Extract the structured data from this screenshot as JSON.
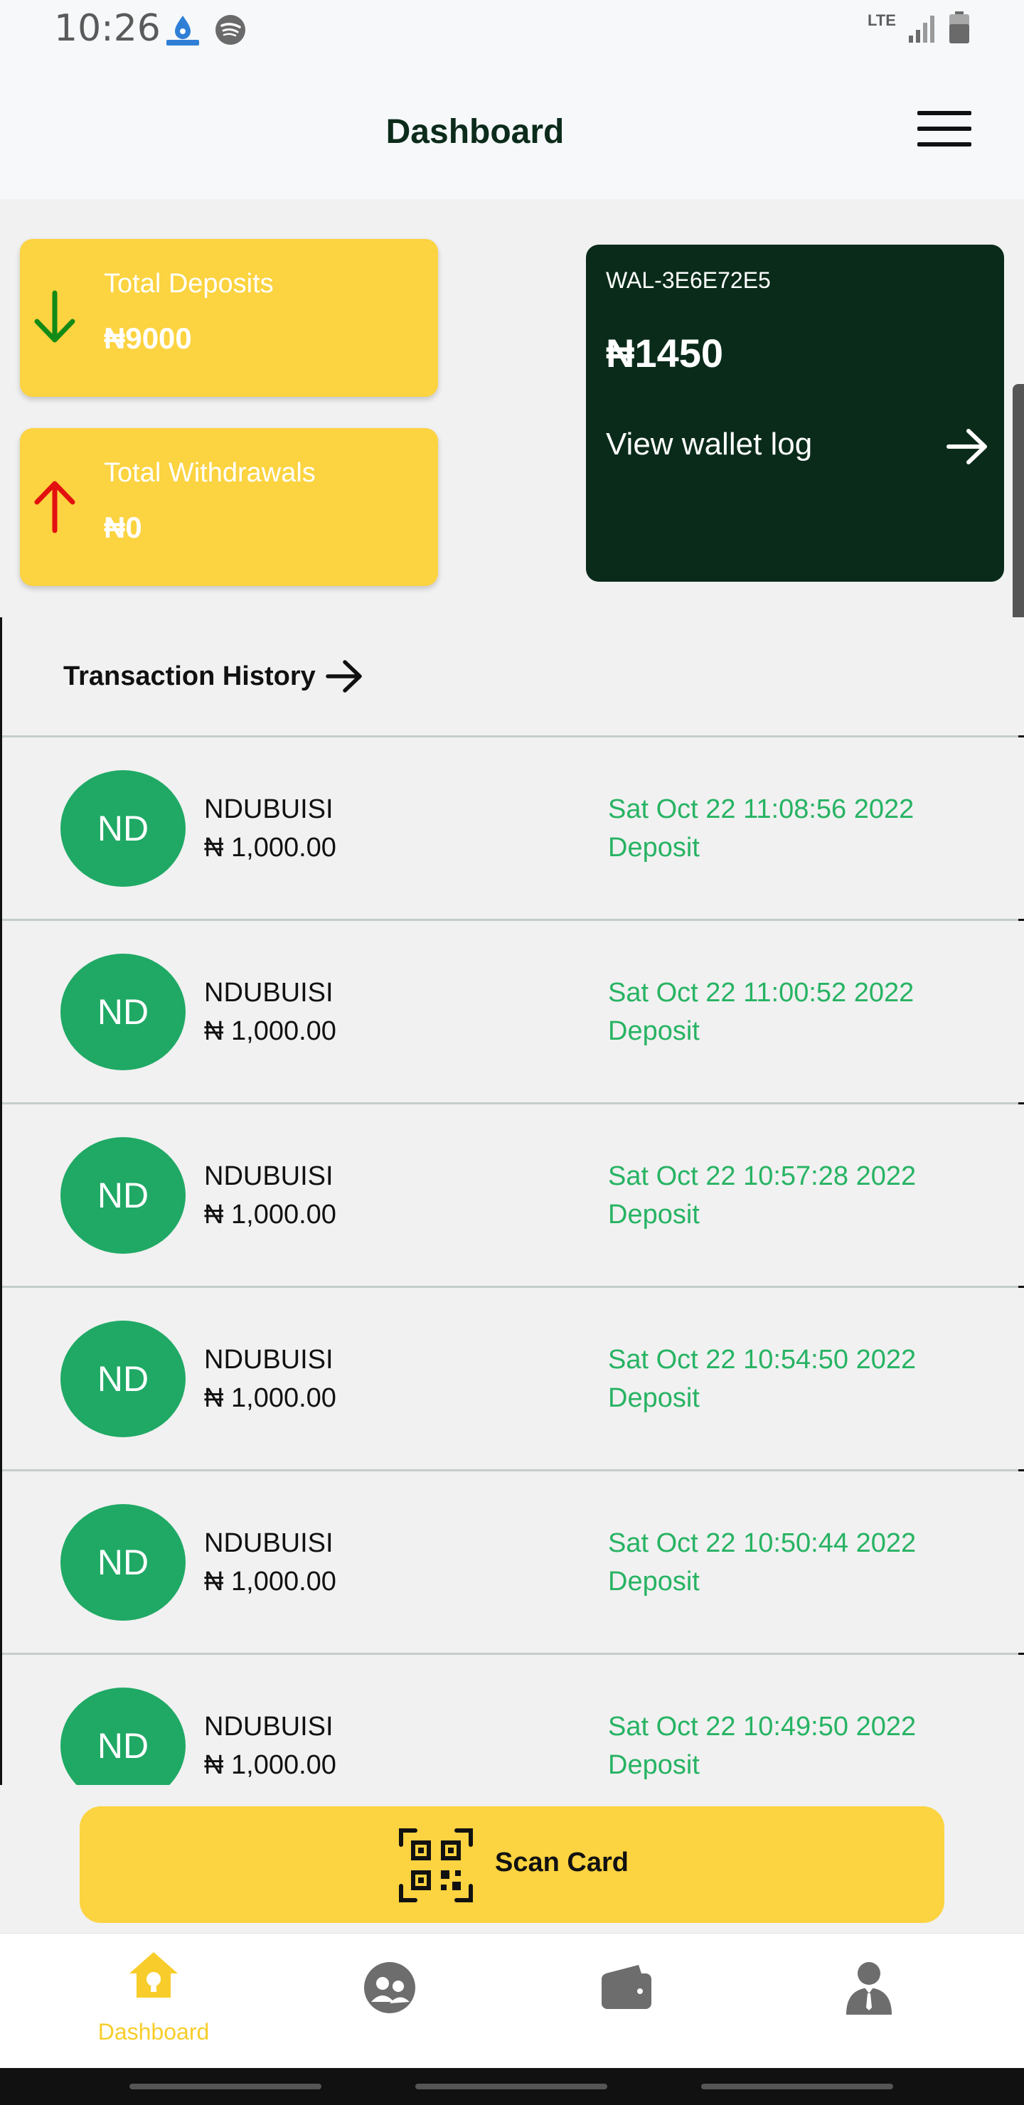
{
  "status_bar": {
    "time": "10:26",
    "network": "LTE",
    "icons": [
      "app-notification-icon",
      "spotify-icon",
      "signal-icon",
      "battery-icon"
    ]
  },
  "header": {
    "title": "Dashboard",
    "menu_icon": "hamburger-menu-icon"
  },
  "stats": {
    "deposits": {
      "label": "Total Deposits",
      "value": "₦9000",
      "icon": "arrow-down-icon",
      "icon_color": "#138a16"
    },
    "withdrawals": {
      "label": "Total Withdrawals",
      "value": "₦0",
      "icon": "arrow-up-icon",
      "icon_color": "#e31010"
    }
  },
  "wallet": {
    "id": "WAL-3E6E72E5",
    "balance": "₦1450",
    "log_label": "View wallet log",
    "arrow_icon": "arrow-right-icon"
  },
  "transactions": {
    "title": "Transaction History",
    "items": [
      {
        "initials": "ND",
        "name": "NDUBUISI",
        "amount": "₦ 1,000.00",
        "date": "Sat Oct 22 11:08:56 2022",
        "type": "Deposit"
      },
      {
        "initials": "ND",
        "name": "NDUBUISI",
        "amount": "₦ 1,000.00",
        "date": "Sat Oct 22 11:00:52 2022",
        "type": "Deposit"
      },
      {
        "initials": "ND",
        "name": "NDUBUISI",
        "amount": "₦ 1,000.00",
        "date": "Sat Oct 22 10:57:28 2022",
        "type": "Deposit"
      },
      {
        "initials": "ND",
        "name": "NDUBUISI",
        "amount": "₦ 1,000.00",
        "date": "Sat Oct 22 10:54:50 2022",
        "type": "Deposit"
      },
      {
        "initials": "ND",
        "name": "NDUBUISI",
        "amount": "₦ 1,000.00",
        "date": "Sat Oct 22 10:50:44 2022",
        "type": "Deposit"
      },
      {
        "initials": "ND",
        "name": "NDUBUISI",
        "amount": "₦ 1,000.00",
        "date": "Sat Oct 22 10:49:50 2022",
        "type": "Deposit"
      }
    ]
  },
  "scan_button": {
    "label": "Scan Card",
    "icon": "qr-code-icon"
  },
  "bottom_nav": {
    "items": [
      {
        "label": "Dashboard",
        "icon": "home-icon",
        "active": true
      },
      {
        "icon": "users-icon",
        "active": false
      },
      {
        "icon": "wallet-icon",
        "active": false
      },
      {
        "icon": "profile-icon",
        "active": false
      }
    ]
  },
  "colors": {
    "accent_yellow": "#fcd340",
    "wallet_dark_green": "#0a2b1a",
    "avatar_green": "#1fa965",
    "transaction_green": "#27b363",
    "nav_active": "#f8cd2b"
  }
}
